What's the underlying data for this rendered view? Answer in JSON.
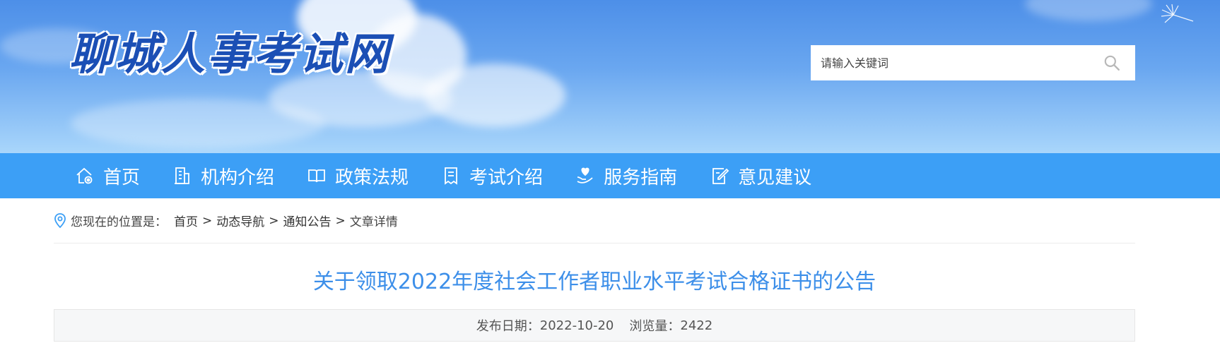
{
  "site": {
    "name": "聊城人事考试网"
  },
  "search": {
    "placeholder": "请输入关键词",
    "icon": "search-icon"
  },
  "nav": {
    "items": [
      {
        "label": "首页",
        "icon": "home-icon"
      },
      {
        "label": "机构介绍",
        "icon": "building-icon"
      },
      {
        "label": "政策法规",
        "icon": "book-icon"
      },
      {
        "label": "考试介绍",
        "icon": "document-icon"
      },
      {
        "label": "服务指南",
        "icon": "hand-heart-icon"
      },
      {
        "label": "意见建议",
        "icon": "edit-icon"
      }
    ]
  },
  "breadcrumb": {
    "prefix": "您现在的位置是：",
    "separator": ">",
    "items": [
      "首页",
      "动态导航",
      "通知公告",
      "文章详情"
    ]
  },
  "article": {
    "title": "关于领取2022年度社会工作者职业水平考试合格证书的公告",
    "date_label": "发布日期：",
    "date": "2022-10-20",
    "views_label": "浏览量：",
    "views": "2422"
  },
  "colors": {
    "nav_bg": "#3c9ff6",
    "title": "#3d8fe9",
    "logo": "#1b4fb5"
  }
}
